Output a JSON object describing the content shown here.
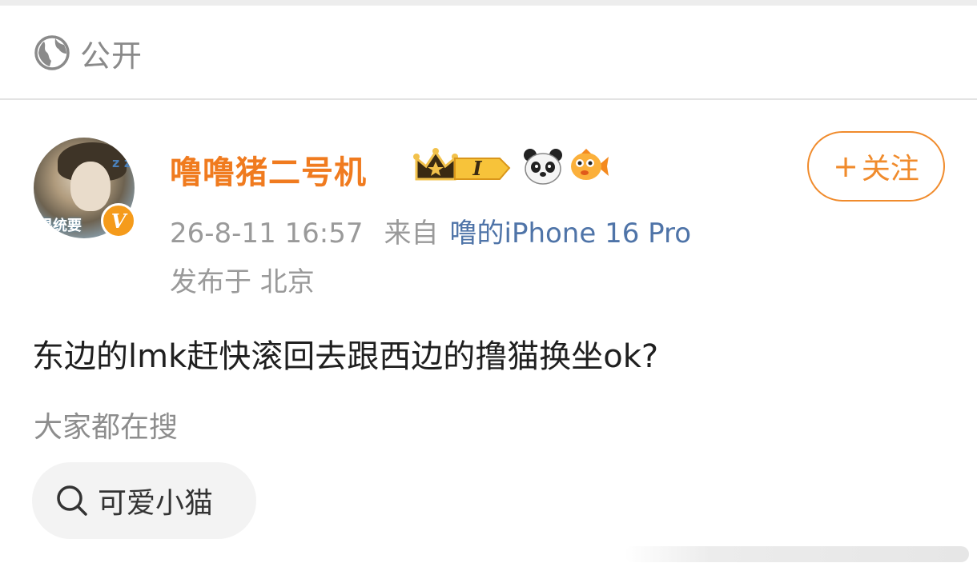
{
  "visibility": {
    "label": "公开",
    "icon": "globe-icon"
  },
  "post": {
    "author": {
      "name": "噜噜猪二号机",
      "avatar_text": "果统要",
      "avatar_badge": "V",
      "badges": [
        "crown-level-badge",
        "panda-emoji",
        "fish-emoji"
      ],
      "level_badge_text": "I"
    },
    "follow_button": {
      "plus": "+",
      "label": "关注"
    },
    "time": "26-8-11 16:57",
    "from_label": "来自",
    "device": "噜的iPhone 16 Pro",
    "location": "发布于 北京",
    "text": "东边的lmk赶快滚回去跟西边的撸猫换坐ok?"
  },
  "search": {
    "header": "大家都在搜",
    "chip_label": "可爱小猫",
    "icon": "search-icon"
  },
  "colors": {
    "accent": "#f07b1f",
    "follow_border": "#f08b2c",
    "link": "#4f74a8",
    "muted": "#9a9a9a"
  }
}
